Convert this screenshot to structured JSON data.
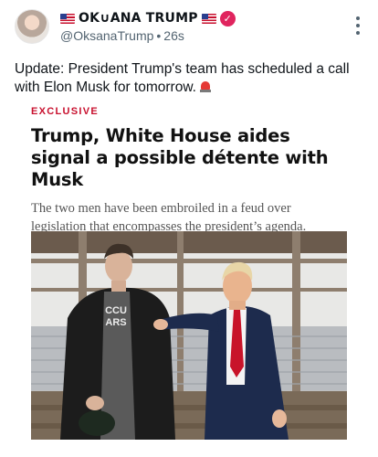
{
  "post": {
    "display_name": "OK∪ANA TRUMP",
    "verified_icon": "verified-badge-icon",
    "handle": "@OksanaTrump",
    "separator": "•",
    "time_ago": "26s",
    "text": "Update: President Trump's team has scheduled a call with Elon Musk for tomorrow.",
    "emoji_icon": "police-siren-icon"
  },
  "article": {
    "label": "EXCLUSIVE",
    "headline": "Trump, White House aides signal a possible détente with Musk",
    "dek": "The two men have been embroiled in a feud over legislation that encompasses the president’s agenda.",
    "photo_icon": "photo-trump-musk",
    "shirt_text_line1": "CCU",
    "shirt_text_line2": "ARS"
  },
  "colors": {
    "accent_red": "#c8102e",
    "verified_badge": "#e0245e",
    "secondary_text": "#536471"
  }
}
